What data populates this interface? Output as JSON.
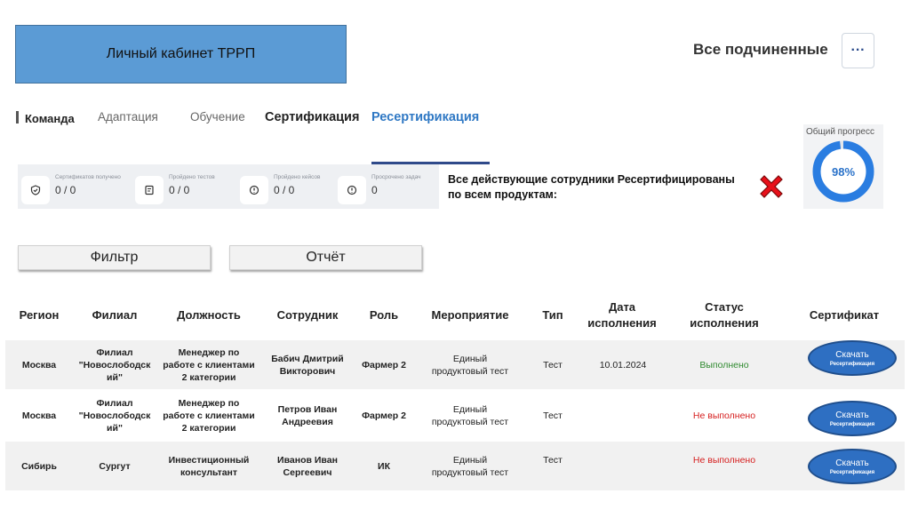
{
  "header": {
    "title": "Личный кабинет ТРРП",
    "subordinates_label": "Все подчиненные",
    "more_label": "···"
  },
  "tabs": [
    {
      "label": "Команда"
    },
    {
      "label": "Адаптация"
    },
    {
      "label": "Обучение"
    },
    {
      "label": "Сертификация"
    },
    {
      "label": "Ресертификация",
      "active": true
    }
  ],
  "stats": [
    {
      "label": "Сертификатов получено",
      "value": "0 / 0",
      "icon": "check-shield-icon"
    },
    {
      "label": "Пройдено тестов",
      "value": "0 / 0",
      "icon": "test-sheet-icon"
    },
    {
      "label": "Пройдено кейсов",
      "value": "0 / 0",
      "icon": "info-icon"
    },
    {
      "label": "Просрочено задач",
      "value": "0",
      "icon": "info-icon"
    }
  ],
  "notice": {
    "text": "Все действующие сотрудники Ресертифицированы по всем продуктам:",
    "icon": "red-cross-icon"
  },
  "progress": {
    "label": "Общий прогресс",
    "value_text": "98%",
    "value": 0.98,
    "color": "#2a7de1"
  },
  "actions": {
    "filter_label": "Фильтр",
    "report_label": "Отчёт"
  },
  "table": {
    "columns": [
      "Регион",
      "Филиал",
      "Должность",
      "Сотрудник",
      "Роль",
      "Мероприятие",
      "Тип",
      "Дата исполнения",
      "Статус исполнения",
      "Сертификат"
    ],
    "rows": [
      {
        "region": "Москва",
        "branch": "Филиал \"Новослободск ий\"",
        "position": "Менеджер по работе с клиентами 2 категории",
        "employee": "Бабич Дмитрий Викторович",
        "role": "Фармер 2",
        "event": "Единый продуктовый тест",
        "type": "Тест",
        "date": "10.01.2024",
        "status": "Выполнено",
        "download": "Скачать",
        "download_sub": "Ресертификация"
      },
      {
        "region": "Москва",
        "branch": "Филиал \"Новослободск ий\"",
        "position": "Менеджер по работе с клиентами 2 категории",
        "employee": "Петров Иван Андреевия",
        "role": "Фармер 2",
        "event": "Единый продуктовый тест",
        "type": "Тест",
        "date": "",
        "status": "Не выполнено",
        "download": "Скачать",
        "download_sub": "Ресертификация"
      },
      {
        "region": "Сибирь",
        "branch": "Сургут",
        "position": "Инвестиционный консультант",
        "employee": "Иванов Иван Сергеевич",
        "role": "ИК",
        "event": "Единый продуктовый тест",
        "type": "Тест",
        "date": "",
        "status": "Не выполнено",
        "download": "Скачать",
        "download_sub": "Ресертификация"
      }
    ]
  }
}
